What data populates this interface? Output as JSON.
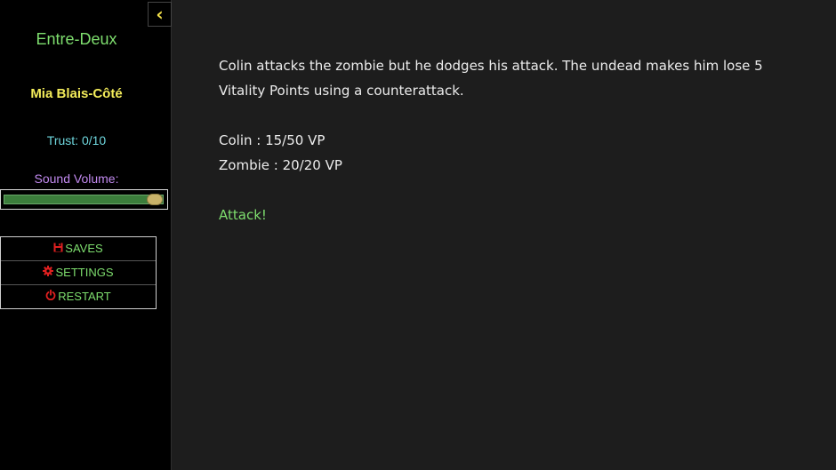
{
  "sidebar": {
    "toggle_icon": "chevron-left-icon",
    "toggle_symbol": "‹",
    "story_title": "Entre-Deux",
    "character_name": "Mia Blais-Côté",
    "trust": "Trust: 0/10",
    "volume_label": "Sound Volume:",
    "volume_level": 0.95,
    "menu": [
      {
        "label": "SAVES",
        "icon": "floppy-disk-icon"
      },
      {
        "label": "SETTINGS",
        "icon": "gear-icon"
      },
      {
        "label": "RESTART",
        "icon": "power-icon"
      }
    ],
    "menu_icon_color": "#e02020"
  },
  "main": {
    "narration": "Colin attacks the zombie but he dodges his attack. The undead makes him lose 5 Vitality Points using a counterattack.",
    "stats": [
      "Colin : 15/50 VP",
      "Zombie : 20/20 VP"
    ],
    "choice": "Attack!"
  },
  "colors": {
    "background": "#1d1d1d",
    "sidebar_bg": "#000000",
    "green": "#7ede6e",
    "yellow": "#f3ec5a",
    "cyan": "#6ed6dd",
    "purple": "#c28af0"
  }
}
